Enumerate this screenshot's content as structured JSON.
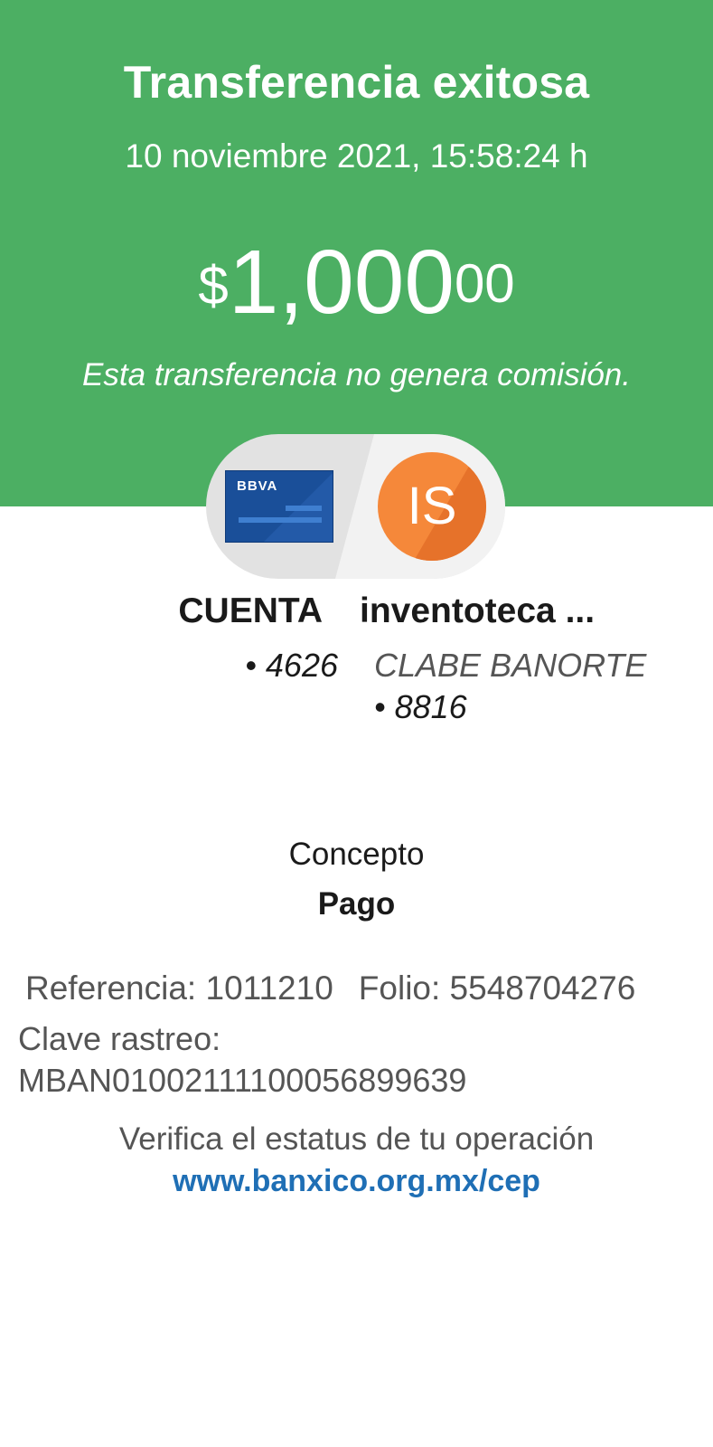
{
  "header": {
    "title": "Transferencia exitosa",
    "datetime": "10 noviembre 2021, 15:58:24 h",
    "amount": {
      "currency": "$",
      "whole": "1,000",
      "cents": "00"
    },
    "commission_note": "Esta transferencia no genera comisión."
  },
  "source": {
    "card_brand": "BBVA",
    "name": "CUENTA",
    "account": "• 4626"
  },
  "destination": {
    "initials": "IS",
    "name": "inventoteca ...",
    "bank": "CLABE BANORTE",
    "account": "• 8816"
  },
  "concept": {
    "label": "Concepto",
    "value": "Pago"
  },
  "details": {
    "reference": "Referencia: 1011210",
    "folio": "Folio: 5548704276",
    "tracking_label": "Clave rastreo:",
    "tracking_value": "MBAN01002111100056899639"
  },
  "verify": {
    "text": "Verifica el estatus de tu operación",
    "link": "www.banxico.org.mx/cep"
  },
  "colors": {
    "header_bg": "#4caf63",
    "avatar": "#f5883a",
    "card": "#1a4f99",
    "link": "#1f6fb5"
  },
  "icons": {
    "source": "bbva-card-icon",
    "destination": "initials-avatar"
  }
}
